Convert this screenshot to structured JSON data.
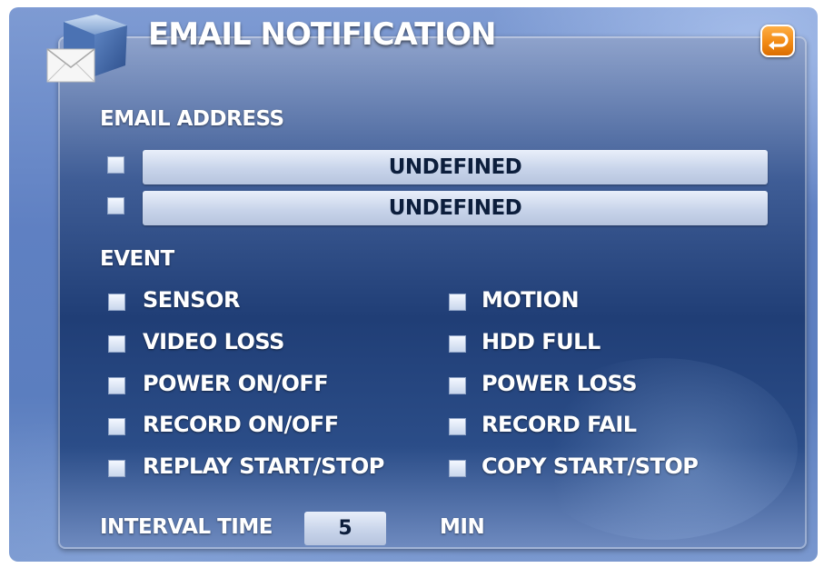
{
  "window": {
    "title": "EMAIL NOTIFICATION"
  },
  "email": {
    "heading": "EMAIL ADDRESS",
    "addresses": [
      {
        "value": "UNDEFINED",
        "checked": false
      },
      {
        "value": "UNDEFINED",
        "checked": false
      }
    ]
  },
  "event": {
    "heading": "EVENT",
    "left": [
      "SENSOR",
      "VIDEO LOSS",
      "POWER ON/OFF",
      "RECORD ON/OFF",
      "REPLAY START/STOP"
    ],
    "right": [
      "MOTION",
      "HDD FULL",
      "POWER LOSS",
      "RECORD FAIL",
      "COPY START/STOP"
    ]
  },
  "interval": {
    "label": "INTERVAL TIME",
    "value": "5",
    "unit": "MIN"
  },
  "icons": {
    "app": "email-envelope-icon",
    "back": "return-arrow-icon"
  },
  "colors": {
    "accent": "#f28a14",
    "panel": "#203e76",
    "field": "#c8d4ea"
  }
}
